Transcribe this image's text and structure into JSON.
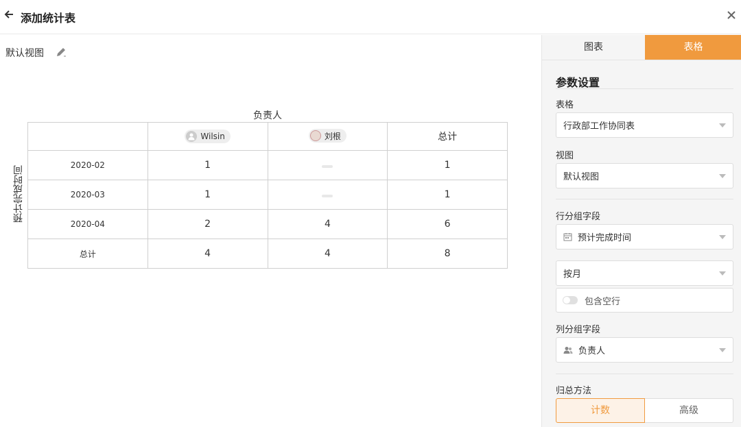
{
  "header": {
    "title": "添加统计表"
  },
  "view": {
    "name": "默认视图"
  },
  "table": {
    "column_title": "负责人",
    "row_title": "预计完成时间",
    "columns": [
      "Wilsin",
      "刘根",
      "总计"
    ],
    "rows": [
      {
        "label": "2020-02",
        "cells": [
          "1",
          "",
          "1"
        ]
      },
      {
        "label": "2020-03",
        "cells": [
          "1",
          "",
          "1"
        ]
      },
      {
        "label": "2020-04",
        "cells": [
          "2",
          "4",
          "6"
        ]
      },
      {
        "label": "总计",
        "cells": [
          "4",
          "4",
          "8"
        ]
      }
    ]
  },
  "panel": {
    "tabs": [
      "图表",
      "表格"
    ],
    "section_title": "参数设置",
    "table_label": "表格",
    "table_value": "行政部工作协同表",
    "view_label": "视图",
    "view_value": "默认视图",
    "row_group_label": "行分组字段",
    "row_group_value": "预计完成时间",
    "granularity_value": "按月",
    "include_empty_label": "包含空行",
    "col_group_label": "列分组字段",
    "col_group_value": "负责人",
    "summary_label": "归总方法",
    "summary_options": [
      "计数",
      "高级"
    ]
  },
  "colors": {
    "accent": "#f09a3e"
  }
}
